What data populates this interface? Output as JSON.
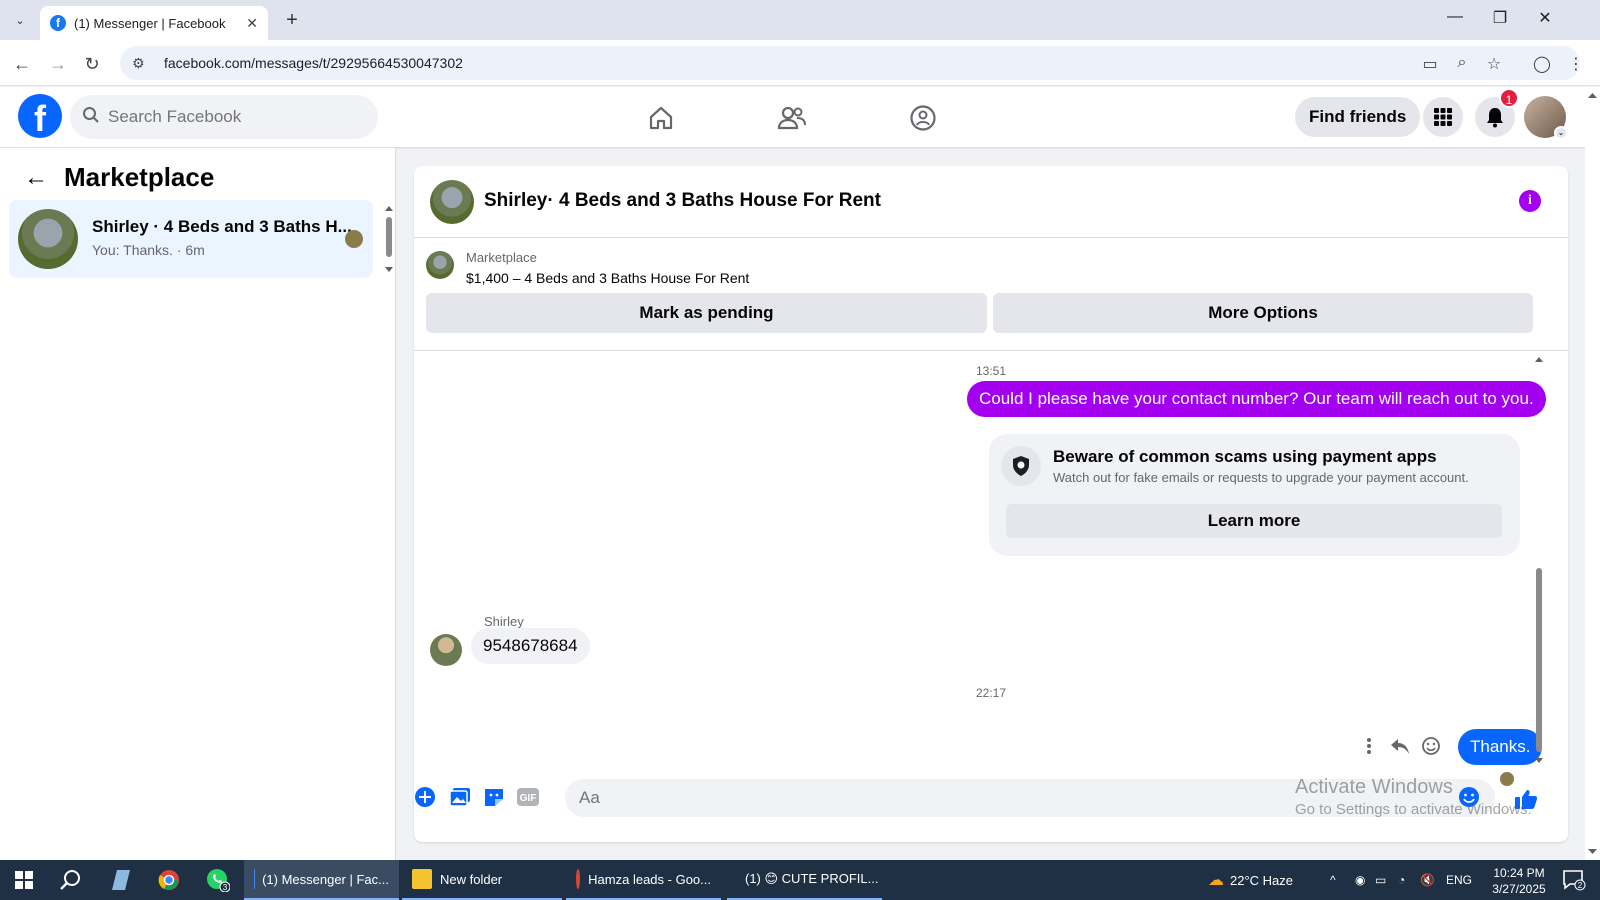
{
  "browser": {
    "tab_title": "(1) Messenger | Facebook",
    "url": "facebook.com/messages/t/29295664530047302"
  },
  "header": {
    "search_placeholder": "Search Facebook",
    "find_friends": "Find friends",
    "notification_count": "1"
  },
  "sidebar": {
    "title": "Marketplace",
    "conversations": [
      {
        "name": "Shirley · 4 Beds and 3 Baths H...",
        "preview": "You: Thanks. · 6m"
      }
    ]
  },
  "chat": {
    "title": "Shirley· 4 Beds and 3 Baths House For Rent",
    "listing": {
      "label": "Marketplace",
      "price_title": "$1,400 – 4 Beds and 3 Baths House For Rent",
      "mark_pending": "Mark as pending",
      "more_options": "More Options"
    },
    "messages": {
      "ts1": "13:51",
      "out1": "Could I please have your contact number? Our team will reach out to you.",
      "scam_title": "Beware of common scams using payment apps",
      "scam_desc": "Watch out for fake emails or requests to upgrade your payment account.",
      "learn_more": "Learn more",
      "sender": "Shirley",
      "in1": "9548678684",
      "ts2": "22:17",
      "out2": "Thanks."
    },
    "composer_placeholder": "Aa"
  },
  "watermark": {
    "line1": "Activate Windows",
    "line2": "Go to Settings to activate Windows."
  },
  "taskbar": {
    "whatsapp_badge": "3",
    "apps": [
      {
        "label": "(1) Messenger | Fac..."
      },
      {
        "label": "New folder"
      },
      {
        "label": "Hamza leads - Goo..."
      },
      {
        "label": "(1) 😊 CUTE PROFIL..."
      }
    ],
    "weather": "22°C  Haze",
    "lang": "ENG",
    "time": "10:24 PM",
    "date": "3/27/2025",
    "notif_count": "2"
  }
}
